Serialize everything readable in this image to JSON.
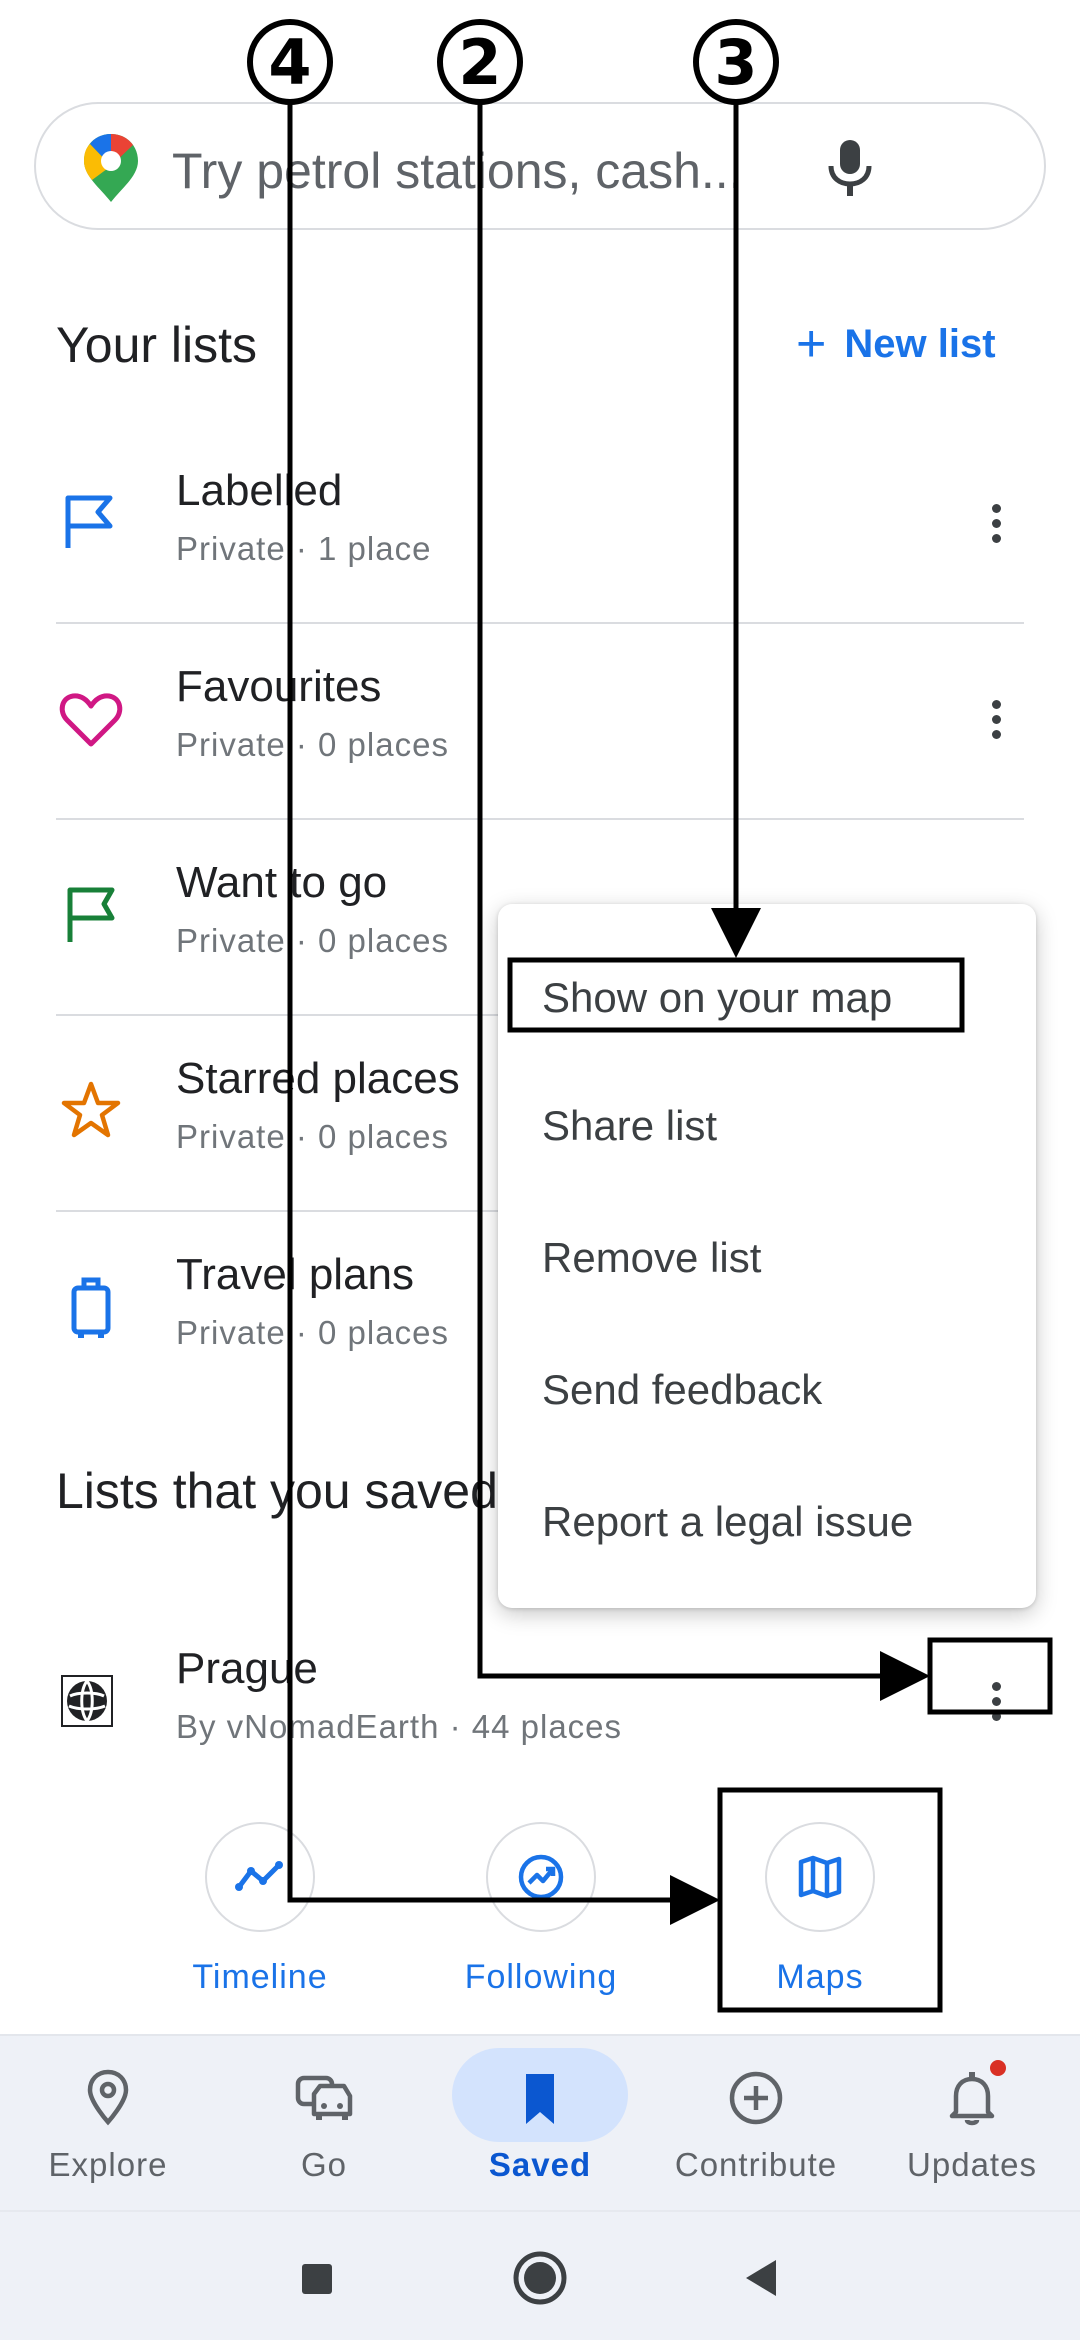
{
  "search": {
    "placeholder": "Try petrol stations, cash..."
  },
  "your_lists": {
    "heading": "Your lists",
    "new_list_label": "New list",
    "items": [
      {
        "title": "Labelled",
        "subtitle": "Private · 1 place",
        "icon": "label-flag-icon",
        "color": "#1a73e8"
      },
      {
        "title": "Favourites",
        "subtitle": "Private · 0 places",
        "icon": "heart-icon",
        "color": "#d01884"
      },
      {
        "title": "Want to go",
        "subtitle": "Private · 0 places",
        "icon": "flag-icon",
        "color": "#188038"
      },
      {
        "title": "Starred places",
        "subtitle": "Private · 0 places",
        "icon": "star-icon",
        "color": "#e37400"
      },
      {
        "title": "Travel plans",
        "subtitle": "Private · 0 places",
        "icon": "suitcase-icon",
        "color": "#1a73e8"
      }
    ]
  },
  "saved_lists": {
    "heading": "Lists that you saved",
    "items": [
      {
        "title": "Prague",
        "subtitle": "By vNomadEarth · 44 places",
        "icon": "globe-avatar-icon"
      }
    ]
  },
  "menu": {
    "items": [
      "Show on your map",
      "Share list",
      "Remove list",
      "Send feedback",
      "Report a legal issue"
    ]
  },
  "shortcuts": [
    {
      "label": "Timeline",
      "icon": "timeline-icon"
    },
    {
      "label": "Following",
      "icon": "following-icon"
    },
    {
      "label": "Maps",
      "icon": "map-icon"
    }
  ],
  "bottom_nav": {
    "tabs": [
      {
        "label": "Explore",
        "icon": "location-pin-icon",
        "active": false
      },
      {
        "label": "Go",
        "icon": "cars-icon",
        "active": false
      },
      {
        "label": "Saved",
        "icon": "bookmark-icon",
        "active": true
      },
      {
        "label": "Contribute",
        "icon": "add-circle-icon",
        "active": false
      },
      {
        "label": "Updates",
        "icon": "bell-icon",
        "active": false
      }
    ]
  },
  "annotations": {
    "numbers": [
      "4",
      "2",
      "3"
    ]
  },
  "colors": {
    "accent": "#1a73e8",
    "active_pill": "#d3e3fd",
    "nav_bg": "#eef1f7"
  }
}
